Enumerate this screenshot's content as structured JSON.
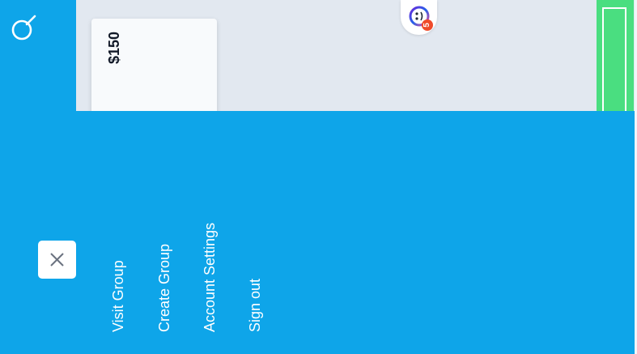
{
  "brand": {
    "logo_icon": "dial-logo-icon",
    "rail_color": "#0ea5e9"
  },
  "card": {
    "price": "$150"
  },
  "notifications": {
    "icon": "smiley-bell-icon",
    "count": "5",
    "badge_color": "#ef4b2b"
  },
  "menu": {
    "close_icon": "close-icon",
    "items": [
      {
        "label": "Visit Group"
      },
      {
        "label": "Create Group"
      },
      {
        "label": "Account Settings"
      },
      {
        "label": "Sign out"
      }
    ]
  },
  "colors": {
    "overlay": "#0ea5e9",
    "content_bg": "#e2e8f0",
    "accent_green": "#4ade80"
  }
}
